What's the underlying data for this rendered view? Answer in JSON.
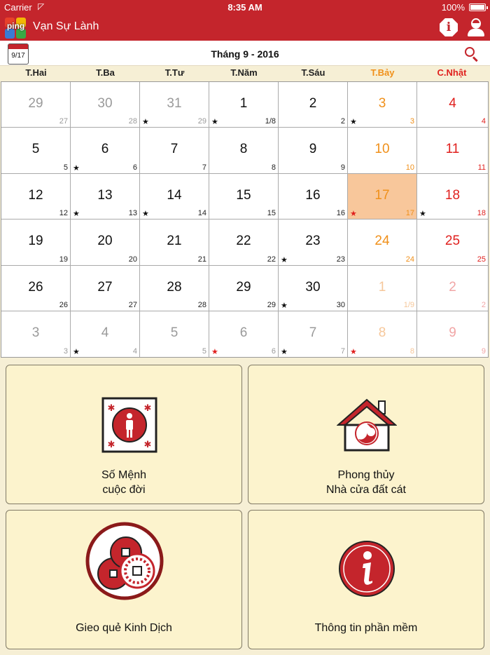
{
  "status": {
    "carrier": "Carrier",
    "time": "8:35 AM",
    "battery": "100%"
  },
  "header": {
    "title": "Vạn Sự Lành",
    "logo_text": "ping"
  },
  "month_bar": {
    "today_chip": "9/17",
    "title": "Tháng 9 - 2016"
  },
  "weekdays": [
    "T.Hai",
    "T.Ba",
    "T.Tư",
    "T.Năm",
    "T.Sáu",
    "T.Bảy",
    "C.Nhật"
  ],
  "calendar": [
    {
      "solar": "29",
      "lunar": "27",
      "other": true,
      "star": ""
    },
    {
      "solar": "30",
      "lunar": "28",
      "other": true,
      "star": ""
    },
    {
      "solar": "31",
      "lunar": "29",
      "other": true,
      "star": "black"
    },
    {
      "solar": "1",
      "lunar": "1/8",
      "other": false,
      "star": "black"
    },
    {
      "solar": "2",
      "lunar": "2",
      "other": false,
      "star": ""
    },
    {
      "solar": "3",
      "lunar": "3",
      "other": false,
      "star": "black"
    },
    {
      "solar": "4",
      "lunar": "4",
      "other": false,
      "star": ""
    },
    {
      "solar": "5",
      "lunar": "5",
      "other": false,
      "star": ""
    },
    {
      "solar": "6",
      "lunar": "6",
      "other": false,
      "star": "black"
    },
    {
      "solar": "7",
      "lunar": "7",
      "other": false,
      "star": ""
    },
    {
      "solar": "8",
      "lunar": "8",
      "other": false,
      "star": ""
    },
    {
      "solar": "9",
      "lunar": "9",
      "other": false,
      "star": ""
    },
    {
      "solar": "10",
      "lunar": "10",
      "other": false,
      "star": ""
    },
    {
      "solar": "11",
      "lunar": "11",
      "other": false,
      "star": ""
    },
    {
      "solar": "12",
      "lunar": "12",
      "other": false,
      "star": ""
    },
    {
      "solar": "13",
      "lunar": "13",
      "other": false,
      "star": "black"
    },
    {
      "solar": "14",
      "lunar": "14",
      "other": false,
      "star": "black"
    },
    {
      "solar": "15",
      "lunar": "15",
      "other": false,
      "star": ""
    },
    {
      "solar": "16",
      "lunar": "16",
      "other": false,
      "star": ""
    },
    {
      "solar": "17",
      "lunar": "17",
      "other": false,
      "star": "red",
      "today": true
    },
    {
      "solar": "18",
      "lunar": "18",
      "other": false,
      "star": "black"
    },
    {
      "solar": "19",
      "lunar": "19",
      "other": false,
      "star": ""
    },
    {
      "solar": "20",
      "lunar": "20",
      "other": false,
      "star": ""
    },
    {
      "solar": "21",
      "lunar": "21",
      "other": false,
      "star": ""
    },
    {
      "solar": "22",
      "lunar": "22",
      "other": false,
      "star": ""
    },
    {
      "solar": "23",
      "lunar": "23",
      "other": false,
      "star": "black"
    },
    {
      "solar": "24",
      "lunar": "24",
      "other": false,
      "star": ""
    },
    {
      "solar": "25",
      "lunar": "25",
      "other": false,
      "star": ""
    },
    {
      "solar": "26",
      "lunar": "26",
      "other": false,
      "star": ""
    },
    {
      "solar": "27",
      "lunar": "27",
      "other": false,
      "star": ""
    },
    {
      "solar": "28",
      "lunar": "28",
      "other": false,
      "star": ""
    },
    {
      "solar": "29",
      "lunar": "29",
      "other": false,
      "star": ""
    },
    {
      "solar": "30",
      "lunar": "30",
      "other": false,
      "star": "black"
    },
    {
      "solar": "1",
      "lunar": "1/9",
      "other": true,
      "star": ""
    },
    {
      "solar": "2",
      "lunar": "2",
      "other": true,
      "star": ""
    },
    {
      "solar": "3",
      "lunar": "3",
      "other": true,
      "star": ""
    },
    {
      "solar": "4",
      "lunar": "4",
      "other": true,
      "star": "black"
    },
    {
      "solar": "5",
      "lunar": "5",
      "other": true,
      "star": ""
    },
    {
      "solar": "6",
      "lunar": "6",
      "other": true,
      "star": "red"
    },
    {
      "solar": "7",
      "lunar": "7",
      "other": true,
      "star": "black"
    },
    {
      "solar": "8",
      "lunar": "8",
      "other": true,
      "star": "red"
    },
    {
      "solar": "9",
      "lunar": "9",
      "other": true,
      "star": ""
    }
  ],
  "star_glyph": "★",
  "tiles": [
    {
      "line1": "Số Mệnh",
      "line2": "cuộc đời",
      "icon": "person-seal-icon"
    },
    {
      "line1": "Phong thủy",
      "line2": "Nhà cửa đất cát",
      "icon": "house-icon"
    },
    {
      "line1": "Gieo quẻ Kinh Dịch",
      "line2": "",
      "icon": "coins-icon"
    },
    {
      "line1": "Thông tin phần mềm",
      "line2": "",
      "icon": "info-circle-icon"
    }
  ],
  "colors": {
    "brand": "#c4252c",
    "saturday": "#f0901a",
    "sunday": "#e0201e",
    "today_bg": "#f8c79b",
    "tile_bg": "#fcf3cd"
  }
}
